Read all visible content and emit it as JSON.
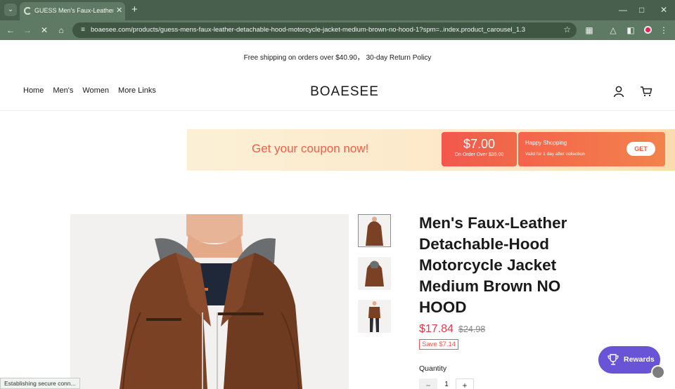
{
  "browser": {
    "tab_title": "GUESS Men's Faux-Leather Det",
    "url": "boaesee.com/products/guess-mens-faux-leather-detachable-hood-motorcycle-jacket-medium-brown-no-hood-1?spm=..index.product_carousel_1.3",
    "status_text": "Establishing secure conn..."
  },
  "store": {
    "announcement": "Free shipping on orders over $40.90， 30-day Return Policy",
    "brand": "BOAESEE",
    "nav": [
      "Home",
      "Men's",
      "Women",
      "More Links"
    ]
  },
  "coupon": {
    "headline": "Get your coupon now!",
    "amount": "$7.00",
    "minimum": "On Order Over $35.00",
    "title": "Happy Shopping",
    "validity": "Valid for 1 day after collection",
    "button": "GET"
  },
  "product": {
    "title": "Men's Faux-Leather Detachable-Hood Motorcycle Jacket Medium Brown NO HOOD",
    "price": "$17.84",
    "compare_price": "$24.98",
    "savings": "Save $7.14",
    "quantity_label": "Quantity",
    "quantity": "1",
    "minus": "−",
    "plus": "+"
  },
  "widgets": {
    "rewards_label": "Rewards"
  },
  "colors": {
    "browser_frame": "#475f4c",
    "accent_red": "#e0394a",
    "coupon_orange": "#f3574c",
    "rewards_purple": "#6a54d6"
  }
}
